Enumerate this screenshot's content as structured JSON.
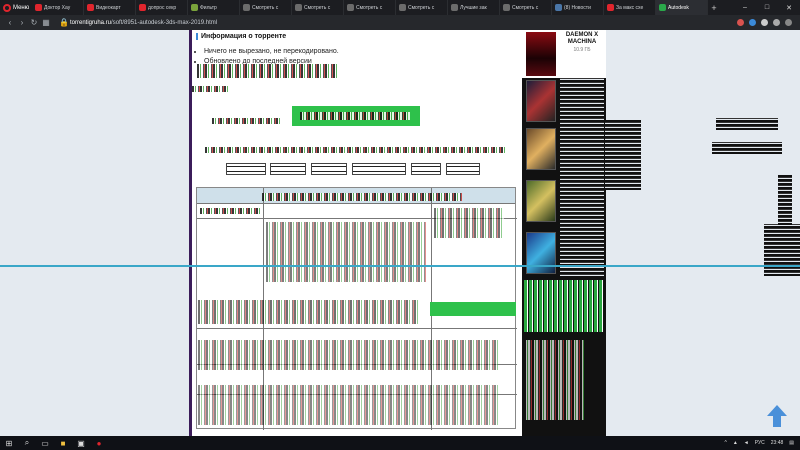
{
  "browser": {
    "menu_label": "Меню",
    "tabs": [
      {
        "label": "Доктор Хау",
        "color": "#e0252d"
      },
      {
        "label": "Видеокарт",
        "color": "#e0252d"
      },
      {
        "label": "допрос секр",
        "color": "#e0252d"
      },
      {
        "label": "Фильтр",
        "color": "#7aa33b"
      },
      {
        "label": "Смотреть с",
        "color": "#6b6b6b"
      },
      {
        "label": "Смотреть с",
        "color": "#6b6b6b"
      },
      {
        "label": "Смотреть с",
        "color": "#6b6b6b"
      },
      {
        "label": "Смотреть с",
        "color": "#6b6b6b"
      },
      {
        "label": "Лучшие зак",
        "color": "#6b6b6b"
      },
      {
        "label": "Смотреть с",
        "color": "#6b6b6b"
      },
      {
        "label": "(8) Новости",
        "color": "#4a76a8"
      },
      {
        "label": "За макс схе",
        "color": "#e0252d"
      },
      {
        "label": "Autodesk",
        "color": "#2aa84a"
      }
    ],
    "active_tab_index": 12,
    "new_tab_glyph": "+",
    "url_host": "torrentigruha.ru",
    "url_path": "/soft/8951-autodesk-3ds-max-2019.html"
  },
  "page": {
    "section_title": "Информация о торренте",
    "bullets": [
      "Ничего не вырезано, не перекодировано.",
      "Обновлено до последней версии"
    ]
  },
  "sidebar": {
    "top_card": {
      "title_line1": "DAEMON X",
      "title_line2": "MACHINA",
      "size": "10.9 ГБ"
    }
  },
  "taskbar": {
    "language": "РУС",
    "time": "23:48"
  },
  "colors": {
    "accent_green": "#2ec14b",
    "accent_blue": "#3b8ad9",
    "scroll_arrow": "#3b8ad9"
  }
}
